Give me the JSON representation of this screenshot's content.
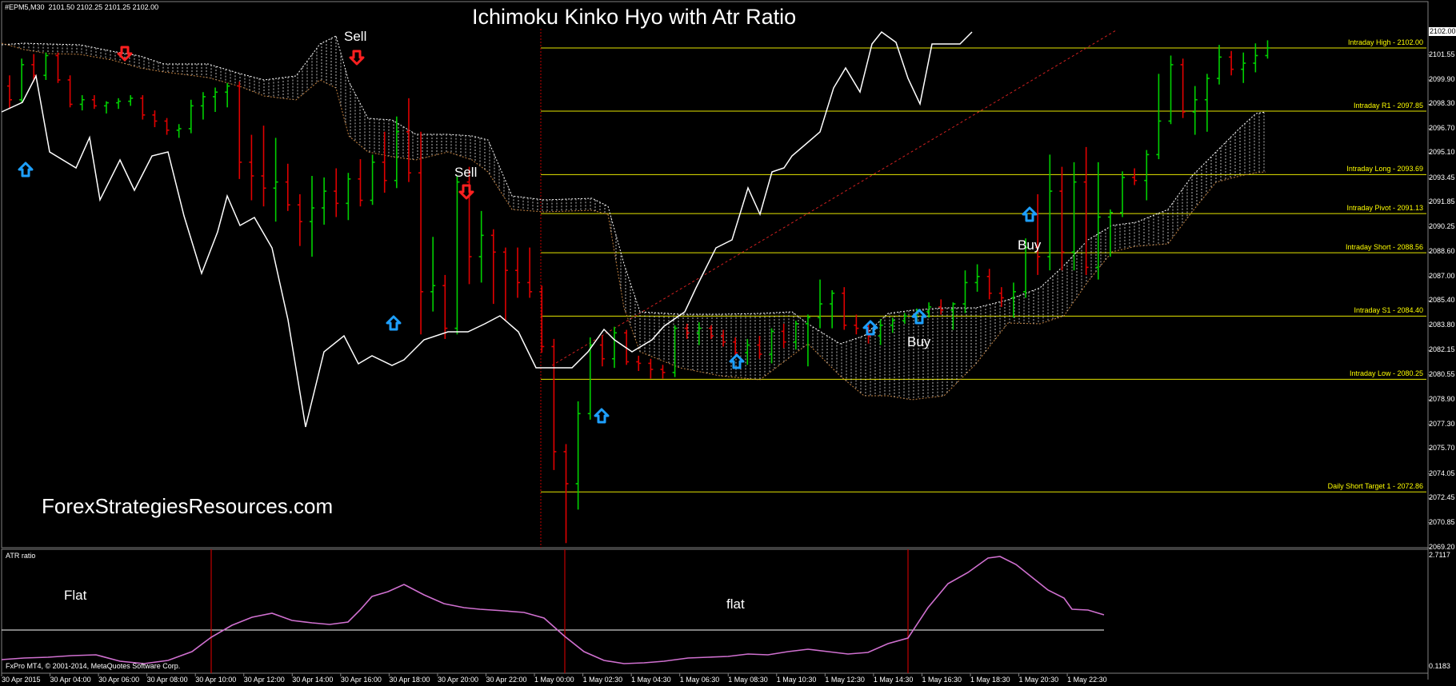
{
  "window": {
    "symbol_info": "#EPM5,M30",
    "ohlc": "2101.50 2102.25 2101.25 2102.00",
    "title": "Ichimoku Kinko Hyo with Atr Ratio",
    "watermark": "ForexStrategiesResources.com",
    "copyright": "FxPro MT4, © 2001-2014, MetaQuotes Software Corp."
  },
  "annotations": {
    "sell1": "Sell",
    "sell2": "Sell",
    "buy1": "Buy",
    "buy2": "Buy",
    "flat1": "Flat",
    "flat2": "flat"
  },
  "levels": [
    {
      "label": "Intraday High - 2102.00",
      "price": 2102.0
    },
    {
      "label": "Intraday R1 - 2097.85",
      "price": 2097.85
    },
    {
      "label": "Intraday Long - 2093.69",
      "price": 2093.69
    },
    {
      "label": "Intraday Pivot - 2091.13",
      "price": 2091.13
    },
    {
      "label": "Intraday Short - 2088.56",
      "price": 2088.56
    },
    {
      "label": "Intraday S1 - 2084.40",
      "price": 2084.4
    },
    {
      "label": "Intraday Low - 2080.25",
      "price": 2080.25
    },
    {
      "label": "Daily Short Target 1 - 2072.86",
      "price": 2072.86
    }
  ],
  "price_axis": {
    "current": "2102.00",
    "ticks": [
      "2101.55",
      "2099.90",
      "2098.30",
      "2096.70",
      "2095.10",
      "2093.45",
      "2091.85",
      "2090.25",
      "2088.60",
      "2087.00",
      "2085.40",
      "2083.80",
      "2082.15",
      "2080.55",
      "2078.90",
      "2077.30",
      "2075.70",
      "2074.05",
      "2072.45",
      "2070.85",
      "2069.20"
    ]
  },
  "time_axis": [
    "30 Apr 2015",
    "30 Apr 04:00",
    "30 Apr 06:00",
    "30 Apr 08:00",
    "30 Apr 10:00",
    "30 Apr 12:00",
    "30 Apr 14:00",
    "30 Apr 16:00",
    "30 Apr 18:00",
    "30 Apr 20:00",
    "30 Apr 22:00",
    "1 May 00:00",
    "1 May 02:30",
    "1 May 04:30",
    "1 May 06:30",
    "1 May 08:30",
    "1 May 10:30",
    "1 May 12:30",
    "1 May 14:30",
    "1 May 16:30",
    "1 May 18:30",
    "1 May 20:30",
    "1 May 22:30"
  ],
  "indicator": {
    "name": "ATR ratio",
    "max": "2.7117",
    "min": "0.1183"
  },
  "colors": {
    "bull": "#00d000",
    "bear": "#e00000",
    "level": "#e6e600",
    "white_line": "#ffffff",
    "cloud": "#c08040",
    "atr_line": "#d070d0",
    "separator": "#c00000",
    "buy_arrow": "#1ea0ff",
    "sell_arrow": "#ff2020"
  },
  "chart_data": {
    "type": "candlestick",
    "symbol": "#EPM5",
    "timeframe": "M30",
    "y_range": [
      2069.2,
      2103.1
    ],
    "indicator_range": [
      0.1183,
      2.7117
    ]
  }
}
